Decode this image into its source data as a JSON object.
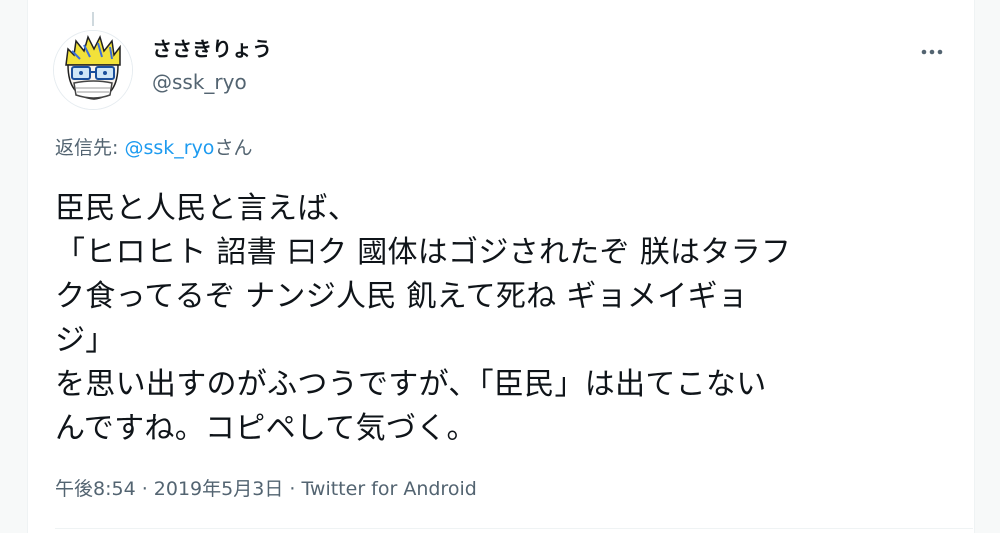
{
  "tweet": {
    "display_name": "ささきりょう",
    "handle": "@ssk_ryo",
    "reply_prefix": "返信先: ",
    "reply_mention": "@ssk_ryo",
    "reply_suffix": "さん",
    "text": "臣民と人民と言えば、\n「ヒロヒト 詔書 曰ク 國体はゴジされたぞ 朕はタラフ\nク食ってるぞ ナンジ人民 飢えて死ね ギョメイギョ\nジ」\nを思い出すのがふつうですが、「臣民」は出てこない\nんですね。コピペして気づく。",
    "time": "午後8:54",
    "separator": " · ",
    "date": "2019年5月3日",
    "source": "Twitter for Android"
  },
  "icons": {
    "more": "more-horizontal-icon",
    "avatar": "cartoon-avatar-with-glasses-and-mask"
  },
  "colors": {
    "accent": "#1d9bf0",
    "secondary_text": "#536471",
    "primary_text": "#0f1419"
  }
}
